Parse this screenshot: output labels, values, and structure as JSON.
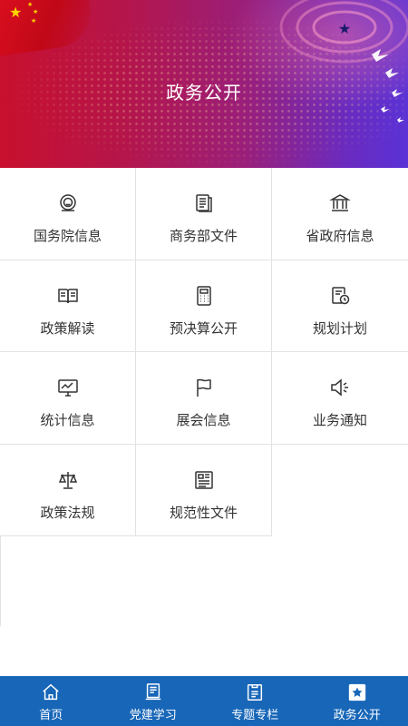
{
  "banner": {
    "title": "政务公开"
  },
  "grid": {
    "items": [
      {
        "label": "国务院信息",
        "icon": "emblem-icon"
      },
      {
        "label": "商务部文件",
        "icon": "document-icon"
      },
      {
        "label": "省政府信息",
        "icon": "government-building-icon"
      },
      {
        "label": "政策解读",
        "icon": "open-book-icon"
      },
      {
        "label": "预决算公开",
        "icon": "calculator-icon"
      },
      {
        "label": "规划计划",
        "icon": "schedule-icon"
      },
      {
        "label": "统计信息",
        "icon": "chart-monitor-icon"
      },
      {
        "label": "展会信息",
        "icon": "flag-icon"
      },
      {
        "label": "业务通知",
        "icon": "speaker-icon"
      },
      {
        "label": "政策法规",
        "icon": "scales-icon"
      },
      {
        "label": "规范性文件",
        "icon": "newspaper-icon"
      }
    ]
  },
  "tabbar": {
    "tabs": [
      {
        "label": "首页",
        "icon": "home-icon"
      },
      {
        "label": "党建学习",
        "icon": "book-icon"
      },
      {
        "label": "专题专栏",
        "icon": "clipboard-icon"
      },
      {
        "label": "政务公开",
        "icon": "star-badge-icon",
        "active": true
      }
    ]
  },
  "colors": {
    "tabbar_bg": "#1766b8",
    "icon_stroke": "#333333",
    "text": "#333333"
  }
}
